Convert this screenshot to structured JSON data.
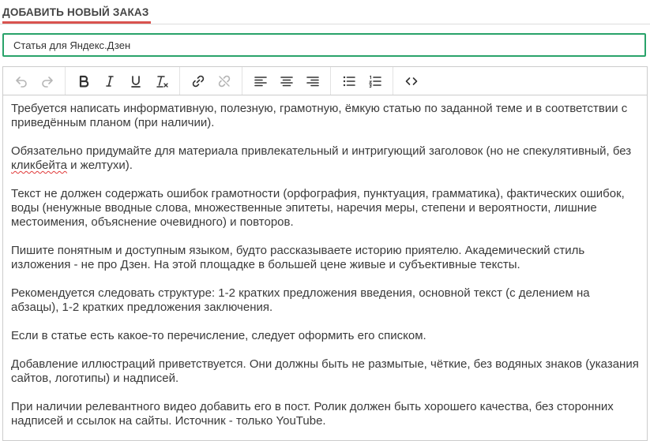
{
  "header": {
    "title": "ДОБАВИТЬ НОВЫЙ ЗАКАЗ"
  },
  "order_title": {
    "value": "Статья для Яндекс.Дзен"
  },
  "toolbar": {
    "buttons": [
      {
        "icon": "undo-icon",
        "enabled": false
      },
      {
        "icon": "redo-icon",
        "enabled": false
      },
      {
        "icon": "bold-icon",
        "enabled": true
      },
      {
        "icon": "italic-icon",
        "enabled": true
      },
      {
        "icon": "underline-icon",
        "enabled": true
      },
      {
        "icon": "clear-format-icon",
        "enabled": true
      },
      {
        "icon": "link-icon",
        "enabled": true
      },
      {
        "icon": "unlink-icon",
        "enabled": false
      },
      {
        "icon": "align-left-icon",
        "enabled": true
      },
      {
        "icon": "align-center-icon",
        "enabled": true
      },
      {
        "icon": "align-right-icon",
        "enabled": true
      },
      {
        "icon": "bullet-list-icon",
        "enabled": true
      },
      {
        "icon": "numbered-list-icon",
        "enabled": true
      },
      {
        "icon": "code-view-icon",
        "enabled": true
      }
    ]
  },
  "editor": {
    "paragraphs": [
      "Требуется написать информативную, полезную, грамотную, ёмкую статью по заданной теме и в соответствии с приведённым планом (при наличии).",
      "Обязательно придумайте для материала привлекательный и интригующий заголовок (но не спекулятивный, без ",
      "Текст не должен содержать ошибок грамотности (орфография, пунктуация, грамматика), фактических ошибок, воды (ненужные вводные слова, множественные эпитеты, наречия меры, степени и вероятности, лишние местоимения, объяснение очевидного) и повторов.",
      "Пишите понятным и доступным языком, будто рассказываете историю приятелю. Академический стиль изложения - не про Дзен. На этой площадке в большей цене живые и субъективные тексты.",
      "Рекомендуется следовать структуре: 1-2 кратких предложения введения, основной текст (с делением на абзацы), 1-2 кратких предложения заключения.",
      "Если в статье есть какое-то перечисление, следует оформить его списком.",
      "Добавление иллюстраций приветствуется. Они должны быть не размытые, чёткие, без водяных знаков (указания сайтов, логотипы) и надписей.",
      "При наличии релевантного видео добавить его в пост. Ролик должен быть хорошего качества, без сторонних надписей и ссылок на сайты. Источник - только YouTube."
    ],
    "p2_misspelled_word": "кликбейта",
    "p2_tail": " и желтухи)."
  }
}
